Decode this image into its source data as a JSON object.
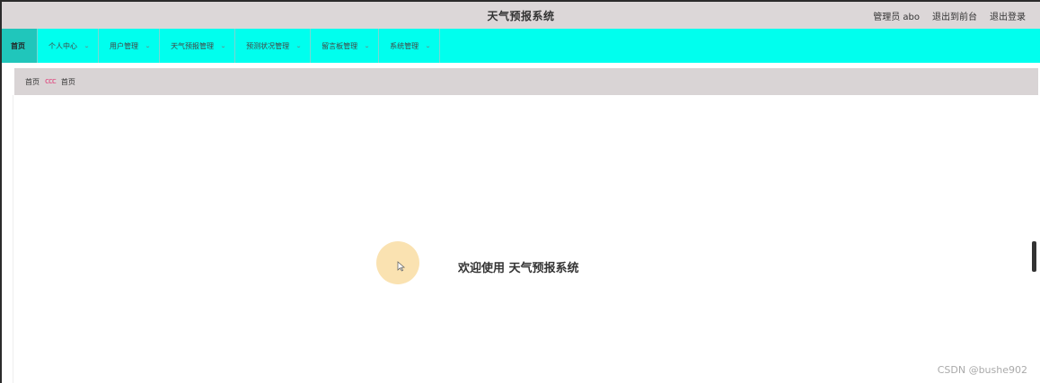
{
  "header": {
    "title": "天气预报系统",
    "admin_label": "管理员 abo",
    "back_to_front": "退出到前台",
    "logout": "退出登录"
  },
  "nav": {
    "items": [
      {
        "label": "首页",
        "active": true
      },
      {
        "label": "个人中心"
      },
      {
        "label": "用户管理"
      },
      {
        "label": "天气预报管理"
      },
      {
        "label": "预测状况管理"
      },
      {
        "label": "留言板管理"
      },
      {
        "label": "系统管理"
      }
    ]
  },
  "breadcrumb": {
    "home": "首页",
    "current": "首页"
  },
  "main": {
    "welcome": "欢迎使用 天气预报系统"
  },
  "watermark": "CSDN @bushe902",
  "colors": {
    "nav_bg": "#00ffee",
    "nav_active": "#20c6bb",
    "header_bg": "#dcd7d8",
    "breadcrumb_bg": "#d9d4d5",
    "breadcrumb_sep": "#e0407a",
    "cursor_halo": "#f9dfa8"
  }
}
